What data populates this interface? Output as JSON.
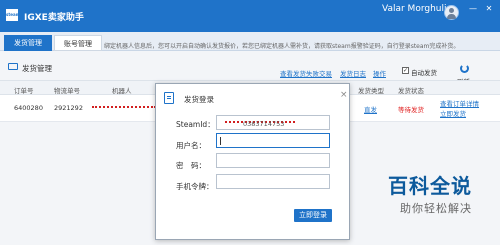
{
  "window": {
    "logo_text": "steam",
    "title": "IGXE卖家助手",
    "user_name": "Valar Morghulis",
    "minimize_glyph": "—",
    "close_glyph": "✕"
  },
  "tabs": [
    {
      "label": "发货管理",
      "active": true
    },
    {
      "label": "账号管理",
      "active": false
    }
  ],
  "notice": "绑定机器人信息后，您可以开启自动确认发货报价，若您已绑定机器人需补货，请获取steam报警验证码，自行登录steam完成补货。",
  "panel": {
    "title": "发货管理",
    "links": [
      "查看发货失败交易",
      "发货日志",
      "操作"
    ],
    "auto_ship_checked": true,
    "auto_ship_label": "自动发货",
    "refresh_label": "刷新"
  },
  "table": {
    "headers": [
      "订单号",
      "物流单号",
      "机器人",
      "发货类型",
      "发货状态"
    ],
    "rows": [
      {
        "order_id": "6400280",
        "logistics_id": "2921292",
        "ship_type": "直发",
        "ship_status": "等待发货",
        "actions": [
          "查看订单详情",
          "立即发货"
        ]
      }
    ]
  },
  "dialog": {
    "title": "发货登录",
    "close_glyph": "×",
    "fields": [
      {
        "label": "SteamId：",
        "value": "0383714753"
      },
      {
        "label": "用户名：",
        "value": ""
      },
      {
        "label": "密　码：",
        "value": ""
      },
      {
        "label": "手机令牌：",
        "value": ""
      }
    ],
    "submit_label": "立即登录"
  },
  "watermark": {
    "title": "百科全说",
    "subtitle": "助你轻松解决"
  },
  "colors": {
    "accent": "#1f73c9",
    "warning": "#e02020"
  }
}
